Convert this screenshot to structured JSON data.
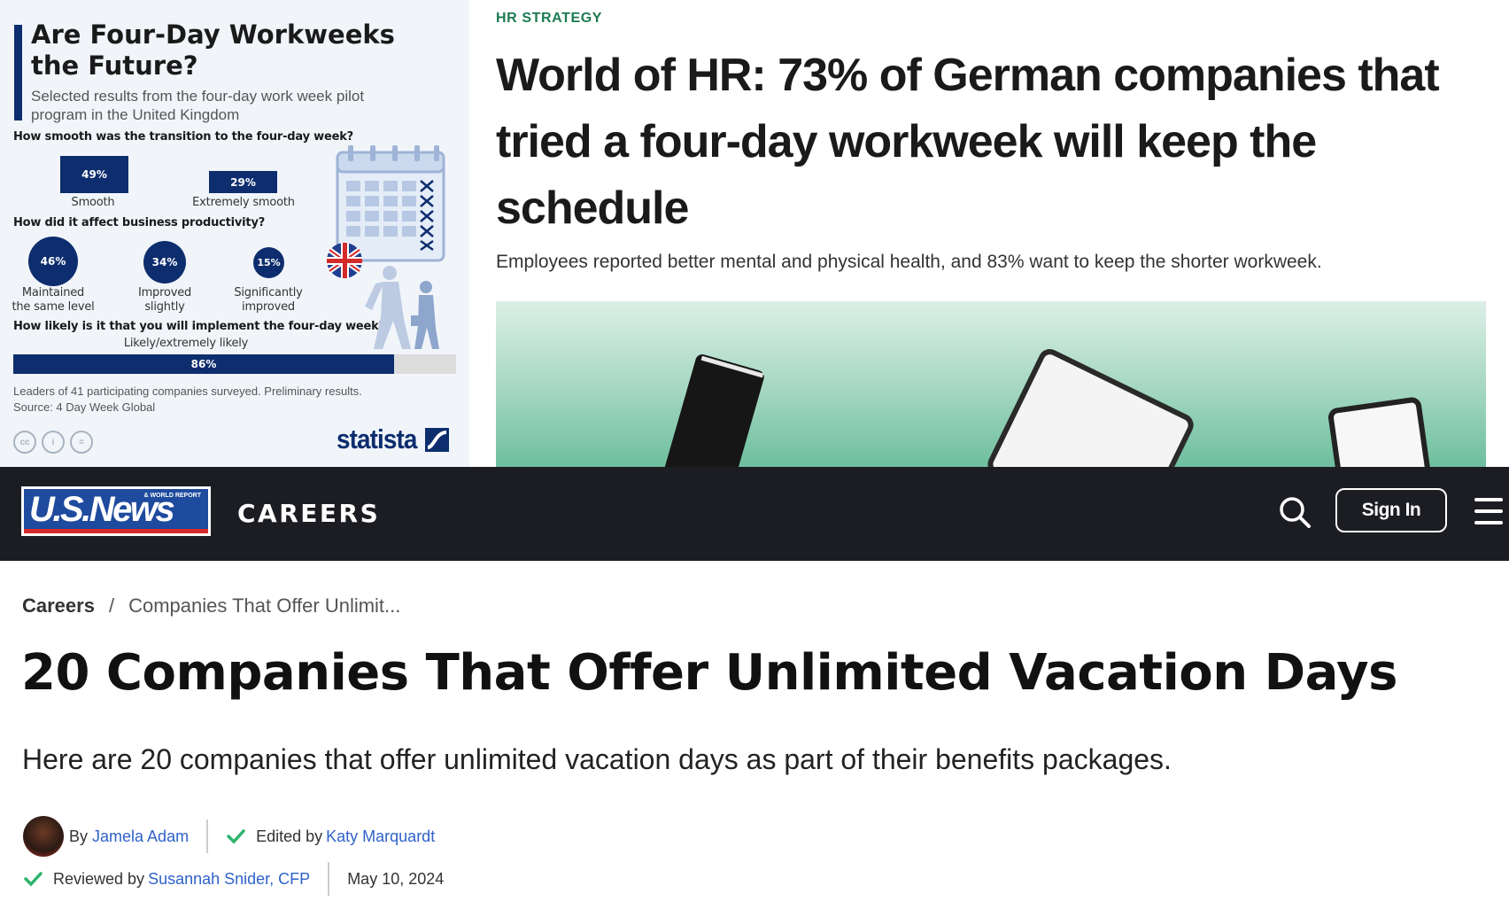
{
  "infographic": {
    "title": "Are Four-Day Workweeks the Future?",
    "subtitle": "Selected results from the four-day work week pilot program in the United Kingdom",
    "q1": {
      "question": "How smooth was the transition to the four-day week?",
      "items": [
        {
          "value": "49%",
          "label": "Smooth"
        },
        {
          "value": "29%",
          "label": "Extremely smooth"
        }
      ]
    },
    "q2": {
      "question": "How did it affect business productivity?",
      "items": [
        {
          "value": "46%",
          "label_line1": "Maintained",
          "label_line2": "the same level"
        },
        {
          "value": "34%",
          "label_line1": "Improved",
          "label_line2": "slightly"
        },
        {
          "value": "15%",
          "label_line1": "Significantly",
          "label_line2": "improved"
        }
      ]
    },
    "q3": {
      "question": "How likely is it that you will implement the four-day week?",
      "bar_label": "Likely/extremely likely",
      "value": "86%",
      "fraction": 0.86
    },
    "footnote": "Leaders of 41 participating companies surveyed. Preliminary results.",
    "source": "Source: 4 Day Week Global",
    "brand": "statista",
    "cc_icons": [
      "cc",
      "i",
      "="
    ],
    "colors": {
      "navy": "#0d2d6e",
      "background": "#f1f5fa"
    }
  },
  "hr_article": {
    "kicker": "HR STRATEGY",
    "headline": "World of HR: 73% of German companies that tried a four-day workweek will keep the schedule",
    "dek": "Employees reported better mental and physical health, and 83% want to keep the shorter workweek.",
    "colors": {
      "kicker": "#1d7a52"
    }
  },
  "usnews": {
    "logo_text": "U.S.News",
    "logo_subtext": "& WORLD REPORT",
    "section": "CAREERS",
    "signin_label": "Sign In",
    "breadcrumb": {
      "root": "Careers",
      "separator": "/",
      "current": "Companies That Offer Unlimit..."
    },
    "title": "20 Companies That Offer Unlimited Vacation Days",
    "dek": "Here are 20 companies that offer unlimited vacation days as part of their benefits packages.",
    "byline": {
      "by_prefix": "By",
      "author": "Jamela Adam",
      "edited_prefix": "Edited by",
      "editor": "Katy Marquardt",
      "reviewed_prefix": "Reviewed by",
      "reviewer": "Susannah Snider, CFP",
      "date": "May 10, 2024"
    },
    "colors": {
      "nav_bg": "#1c1d22",
      "link": "#2f62c9",
      "check": "#2db36b"
    }
  }
}
